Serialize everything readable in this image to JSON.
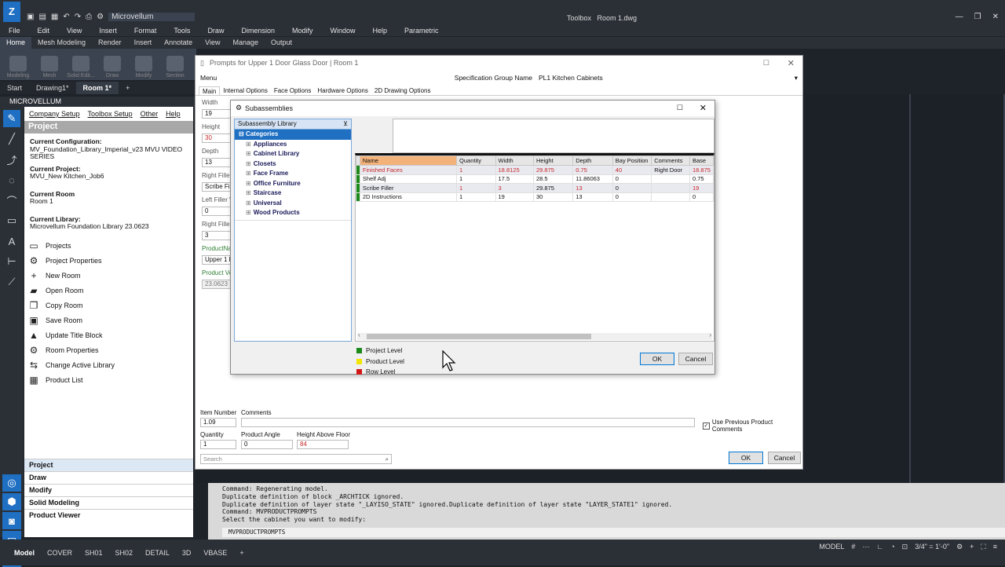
{
  "app": {
    "title": "Toolbox   Room 1.dwg",
    "quick_access_label": "Microvellum"
  },
  "menubar": [
    "File",
    "Edit",
    "View",
    "Insert",
    "Format",
    "Tools",
    "Draw",
    "Dimension",
    "Modify",
    "Window",
    "Help",
    "Parametric"
  ],
  "ribbon_tabs": [
    "Home",
    "Mesh Modeling",
    "Render",
    "Insert",
    "Annotate",
    "View",
    "Manage",
    "Output"
  ],
  "ribbon_buttons": [
    "Modeling",
    "Mesh",
    "Solid Edit...",
    "Draw",
    "Modify",
    "Section"
  ],
  "doc_tabs": [
    "Start",
    "Drawing1*",
    "Room 1*"
  ],
  "mv_panel": {
    "header": "MICROVELLUM",
    "menu": [
      "Company Setup",
      "Toolbox Setup",
      "Other",
      "Help"
    ],
    "section_title": "Project",
    "current_configuration_label": "Current Configuration:",
    "current_configuration": "MV_Foundation_Library_Imperial_v23 MVU VIDEO SERIES",
    "current_project_label": "Current Project:",
    "current_project": "MVU_New Kitchen_Job6",
    "current_room_label": "Current Room",
    "current_room": "Room 1",
    "current_library_label": "Current Library:",
    "current_library": "Microvellum Foundation Library 23.0623",
    "actions": [
      {
        "label": "Projects",
        "icon": "monitor-icon"
      },
      {
        "label": "Project Properties",
        "icon": "gear-icon"
      },
      {
        "label": "New Room",
        "icon": "plus-icon"
      },
      {
        "label": "Open Room",
        "icon": "folder-open-icon"
      },
      {
        "label": "Copy Room",
        "icon": "copy-icon"
      },
      {
        "label": "Save Room",
        "icon": "save-icon"
      },
      {
        "label": "Update Title Block",
        "icon": "title-block-icon"
      },
      {
        "label": "Room Properties",
        "icon": "gear-icon"
      },
      {
        "label": "Change Active Library",
        "icon": "swap-icon"
      },
      {
        "label": "Product List",
        "icon": "list-icon"
      }
    ],
    "nav": [
      "Project",
      "Draw",
      "Modify",
      "Solid Modeling",
      "Product Viewer"
    ]
  },
  "prompts_dialog": {
    "title": "Prompts for Upper 1 Door Glass Door | Room 1",
    "menu_label": "Menu",
    "spec_group_label": "Specification Group Name",
    "spec_group_value": "PL1 Kitchen Cabinets",
    "tabs": [
      "Main",
      "Internal Options",
      "Face Options",
      "Hardware Options",
      "2D Drawing Options"
    ],
    "fields": [
      {
        "label": "Width",
        "value": "19"
      },
      {
        "label": "Height",
        "value": "30"
      },
      {
        "label": "Depth",
        "value": "13"
      },
      {
        "label": "Right Filler",
        "value": "Scribe Filler"
      },
      {
        "label": "Left Filler W",
        "value": "0"
      },
      {
        "label": "Right Filler",
        "value": "3"
      },
      {
        "label": "ProductNam",
        "value": "Upper 1 Do"
      },
      {
        "label": "Product Ve",
        "value": "23.0623"
      }
    ],
    "item_number_label": "Item Number",
    "item_number": "1.09",
    "comments_label": "Comments",
    "comments": "",
    "use_prev_comments_label": "Use Previous Product Comments",
    "quantity_label": "Quantity",
    "quantity": "1",
    "angle_label": "Product Angle",
    "angle": "0",
    "height_floor_label": "Height Above Floor",
    "height_floor": "84",
    "search_placeholder": "Search",
    "ok_label": "OK",
    "cancel_label": "Cancel"
  },
  "subassemblies_dialog": {
    "title": "Subassemblies",
    "library_header": "Subassembly Library",
    "categories_label": "Categories",
    "categories": [
      "Appliances",
      "Cabinet Library",
      "Closets",
      "Face Frame",
      "Office Furniture",
      "Staircase",
      "Universal",
      "Wood Products"
    ],
    "columns": [
      "Name",
      "Quantity",
      "Width",
      "Height",
      "Depth",
      "Bay Position",
      "Comments",
      "Base"
    ],
    "rows": [
      {
        "level": "project",
        "cells": [
          "Finished Faces",
          "1",
          "18.8125",
          "29.875",
          "0.75",
          "40",
          "Right Door",
          "18.875"
        ],
        "red": [
          0,
          1,
          2,
          3,
          4,
          5,
          7
        ]
      },
      {
        "level": "project",
        "cells": [
          "Shelf Adj",
          "1",
          "17.5",
          "28.5",
          "11.86063",
          "0",
          "",
          "0.75"
        ],
        "red": []
      },
      {
        "level": "project",
        "cells": [
          "Scribe Filler",
          "1",
          "3",
          "29.875",
          "13",
          "0",
          "",
          "19"
        ],
        "red": [
          1,
          2,
          4,
          7
        ]
      },
      {
        "level": "project",
        "cells": [
          "2D Instructions",
          "1",
          "19",
          "30",
          "13",
          "0",
          "",
          "0"
        ],
        "red": []
      }
    ],
    "legend": [
      {
        "label": "Project Level",
        "color": "#1b8a1b"
      },
      {
        "label": "Product Level",
        "color": "#f2e600"
      },
      {
        "label": "Row Level",
        "color": "#d01616"
      }
    ],
    "ok_label": "OK",
    "cancel_label": "Cancel"
  },
  "command_lines": [
    "Command: Regenerating model.",
    "Duplicate definition of block _ARCHTICK  ignored.",
    "Duplicate definition of layer state \"_LAYISO_STATE\" ignored.Duplicate definition of layer state \"LAYER_STATE1\" ignored.",
    "Command: MVPRODUCTPROMPTS",
    "Select the cabinet you want to modify:"
  ],
  "command_input": "MVPRODUCTPROMPTS",
  "status_tabs": [
    "Model",
    "COVER",
    "SH01",
    "SH02",
    "DETAIL",
    "3D",
    "VBASE"
  ],
  "status_right": {
    "mode": "MODEL",
    "scale": "3/4\" = 1'-0\""
  }
}
